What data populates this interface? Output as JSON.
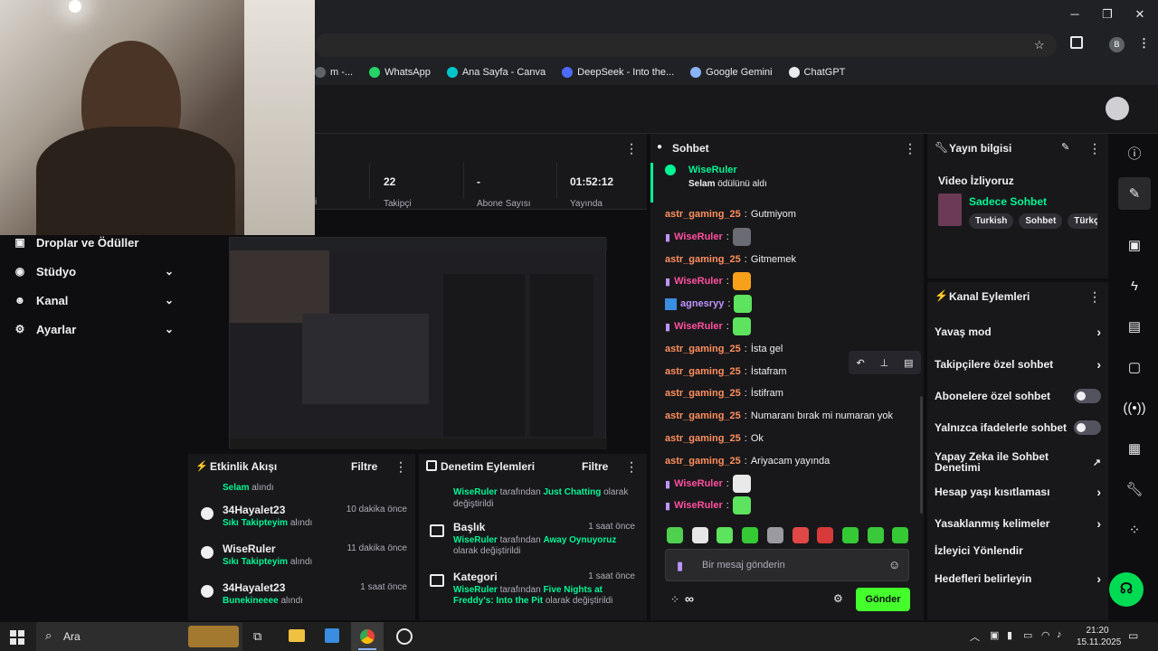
{
  "browser": {
    "bookmarks": [
      {
        "label": "m -...",
        "icon": "tab-icon",
        "color": "#5f6368"
      },
      {
        "label": "WhatsApp",
        "icon": "whatsapp-icon",
        "color": "#25d366"
      },
      {
        "label": "Ana Sayfa - Canva",
        "icon": "canva-icon",
        "color": "#00c4cc"
      },
      {
        "label": "DeepSeek - Into the...",
        "icon": "deepseek-icon",
        "color": "#4d6bfe"
      },
      {
        "label": "Google Gemini",
        "icon": "gemini-icon",
        "color": "#8ab4f8"
      },
      {
        "label": "ChatGPT",
        "icon": "chatgpt-icon",
        "color": "#e8eaed"
      }
    ],
    "profile_initial": "B"
  },
  "nav": {
    "items": [
      {
        "label": "Droplar ve Ödüller",
        "icon": "gift-icon",
        "chevron": false
      },
      {
        "label": "Stüdyo",
        "icon": "studio-icon",
        "chevron": true
      },
      {
        "label": "Kanal",
        "icon": "users-icon",
        "chevron": true
      },
      {
        "label": "Ayarlar",
        "icon": "gear-icon",
        "chevron": true
      }
    ]
  },
  "stats": {
    "items": [
      {
        "value": "22",
        "label": "Takipçi"
      },
      {
        "value": "-",
        "label": "Abone Sayısı"
      },
      {
        "value": "01:52:12",
        "label": "Yayında"
      }
    ],
    "partial_label": "i"
  },
  "activity": {
    "title": "Etkinlik Akışı",
    "filter": "Filtre",
    "top_partial": {
      "name": "Selam",
      "suffix": "alındı"
    },
    "items": [
      {
        "name": "34Hayalet23",
        "reward": "Sıkı Takipteyim",
        "suffix": "alındı",
        "time": "10 dakika önce"
      },
      {
        "name": "WiseRuler",
        "reward": "Sıkı Takipteyim",
        "suffix": "alındı",
        "time": "11 dakika önce"
      },
      {
        "name": "34Hayalet23",
        "reward": "Bunekineeee",
        "suffix": "alındı",
        "time": "1 saat önce"
      }
    ]
  },
  "moderation": {
    "title": "Denetim Eylemleri",
    "filter": "Filtre",
    "top_partial": {
      "user": "WiseRuler",
      "mid": "tarafından",
      "value": "Just Chatting",
      "end": "olarak değiştirildi"
    },
    "items": [
      {
        "title": "Başlık",
        "time": "1 saat önce",
        "user": "WiseRuler",
        "mid": "tarafından",
        "value": "Away Oynuyoruz",
        "end": "olarak değiştirildi"
      },
      {
        "title": "Kategori",
        "time": "1 saat önce",
        "user": "WiseRuler",
        "mid": "tarafından",
        "value": "Five Nights at Freddy's: Into the Pit",
        "end": "olarak değiştirildi"
      }
    ]
  },
  "chat": {
    "title": "Sohbet",
    "reward": {
      "user": "WiseRuler",
      "reward": "Selam",
      "text": "ödülünü aldı"
    },
    "messages": [
      {
        "user": "astr_gaming_25",
        "text": "Gutmiyom",
        "style": "astr"
      },
      {
        "user": "WiseRuler",
        "text": "",
        "style": "wise",
        "emote": "#6b6b75"
      },
      {
        "user": "astr_gaming_25",
        "text": "Gitmemek",
        "style": "astr"
      },
      {
        "user": "WiseRuler",
        "text": "",
        "style": "wise",
        "emote": "#f7a11a"
      },
      {
        "user": "agnesryy",
        "text": "",
        "style": "agn",
        "emote": "#5de35d"
      },
      {
        "user": "WiseRuler",
        "text": "",
        "style": "wise",
        "emote": "#5de35d"
      },
      {
        "user": "astr_gaming_25",
        "text": "İsta gel",
        "style": "astr"
      },
      {
        "user": "astr_gaming_25",
        "text": "İstafram",
        "style": "astr"
      },
      {
        "user": "astr_gaming_25",
        "text": "İstifram",
        "style": "astr"
      },
      {
        "user": "astr_gaming_25",
        "text": "Numaranı bırak mi numaran yok",
        "style": "astr"
      },
      {
        "user": "astr_gaming_25",
        "text": "Ok",
        "style": "astr"
      },
      {
        "user": "astr_gaming_25",
        "text": "Ariyacam yayında",
        "style": "astr"
      },
      {
        "user": "WiseRuler",
        "text": "",
        "style": "wise",
        "emote": "#e9e9e9"
      },
      {
        "user": "WiseRuler",
        "text": "",
        "style": "wise",
        "emote": "#5de35d"
      }
    ],
    "emote_bar": [
      "#4fd14f",
      "#e6e6e6",
      "#5de35d",
      "#35c935",
      "#9a9aa0",
      "#e04848",
      "#d63a3a",
      "#36c936",
      "#3ac93a",
      "#35c935"
    ],
    "input_placeholder": "Bir mesaj gönderin",
    "send_label": "Gönder",
    "points_label": "∞"
  },
  "stream_info": {
    "title": "Yayın bilgisi",
    "watching": "Video İzliyoruz",
    "category": "Sadece Sohbet",
    "tags": [
      "Turkish",
      "Sohbet",
      "Türkçe"
    ]
  },
  "channel_actions": {
    "title": "Kanal Eylemleri",
    "items": [
      {
        "label": "Yavaş mod",
        "control": "chevron"
      },
      {
        "label": "Takipçilere özel sohbet",
        "control": "chevron"
      },
      {
        "label": "Abonelere özel sohbet",
        "control": "toggle"
      },
      {
        "label": "Yalnızca ifadelerle sohbet",
        "control": "toggle"
      },
      {
        "label": "Yapay Zeka ile Sohbet Denetimi",
        "control": "external"
      },
      {
        "label": "Hesap yaşı kısıtlaması",
        "control": "chevron"
      },
      {
        "label": "Yasaklanmış kelimeler",
        "control": "chevron"
      },
      {
        "label": "İzleyici Yönlendir",
        "control": "none"
      },
      {
        "label": "Hedefleri belirleyin",
        "control": "chevron"
      }
    ]
  },
  "taskbar": {
    "search_label": "Ara",
    "time": "21:20",
    "date": "15.11.2025"
  },
  "colors": {
    "accent_green": "#00f593",
    "send_green": "#45ff2d",
    "twitch_purple": "#9147ff"
  }
}
